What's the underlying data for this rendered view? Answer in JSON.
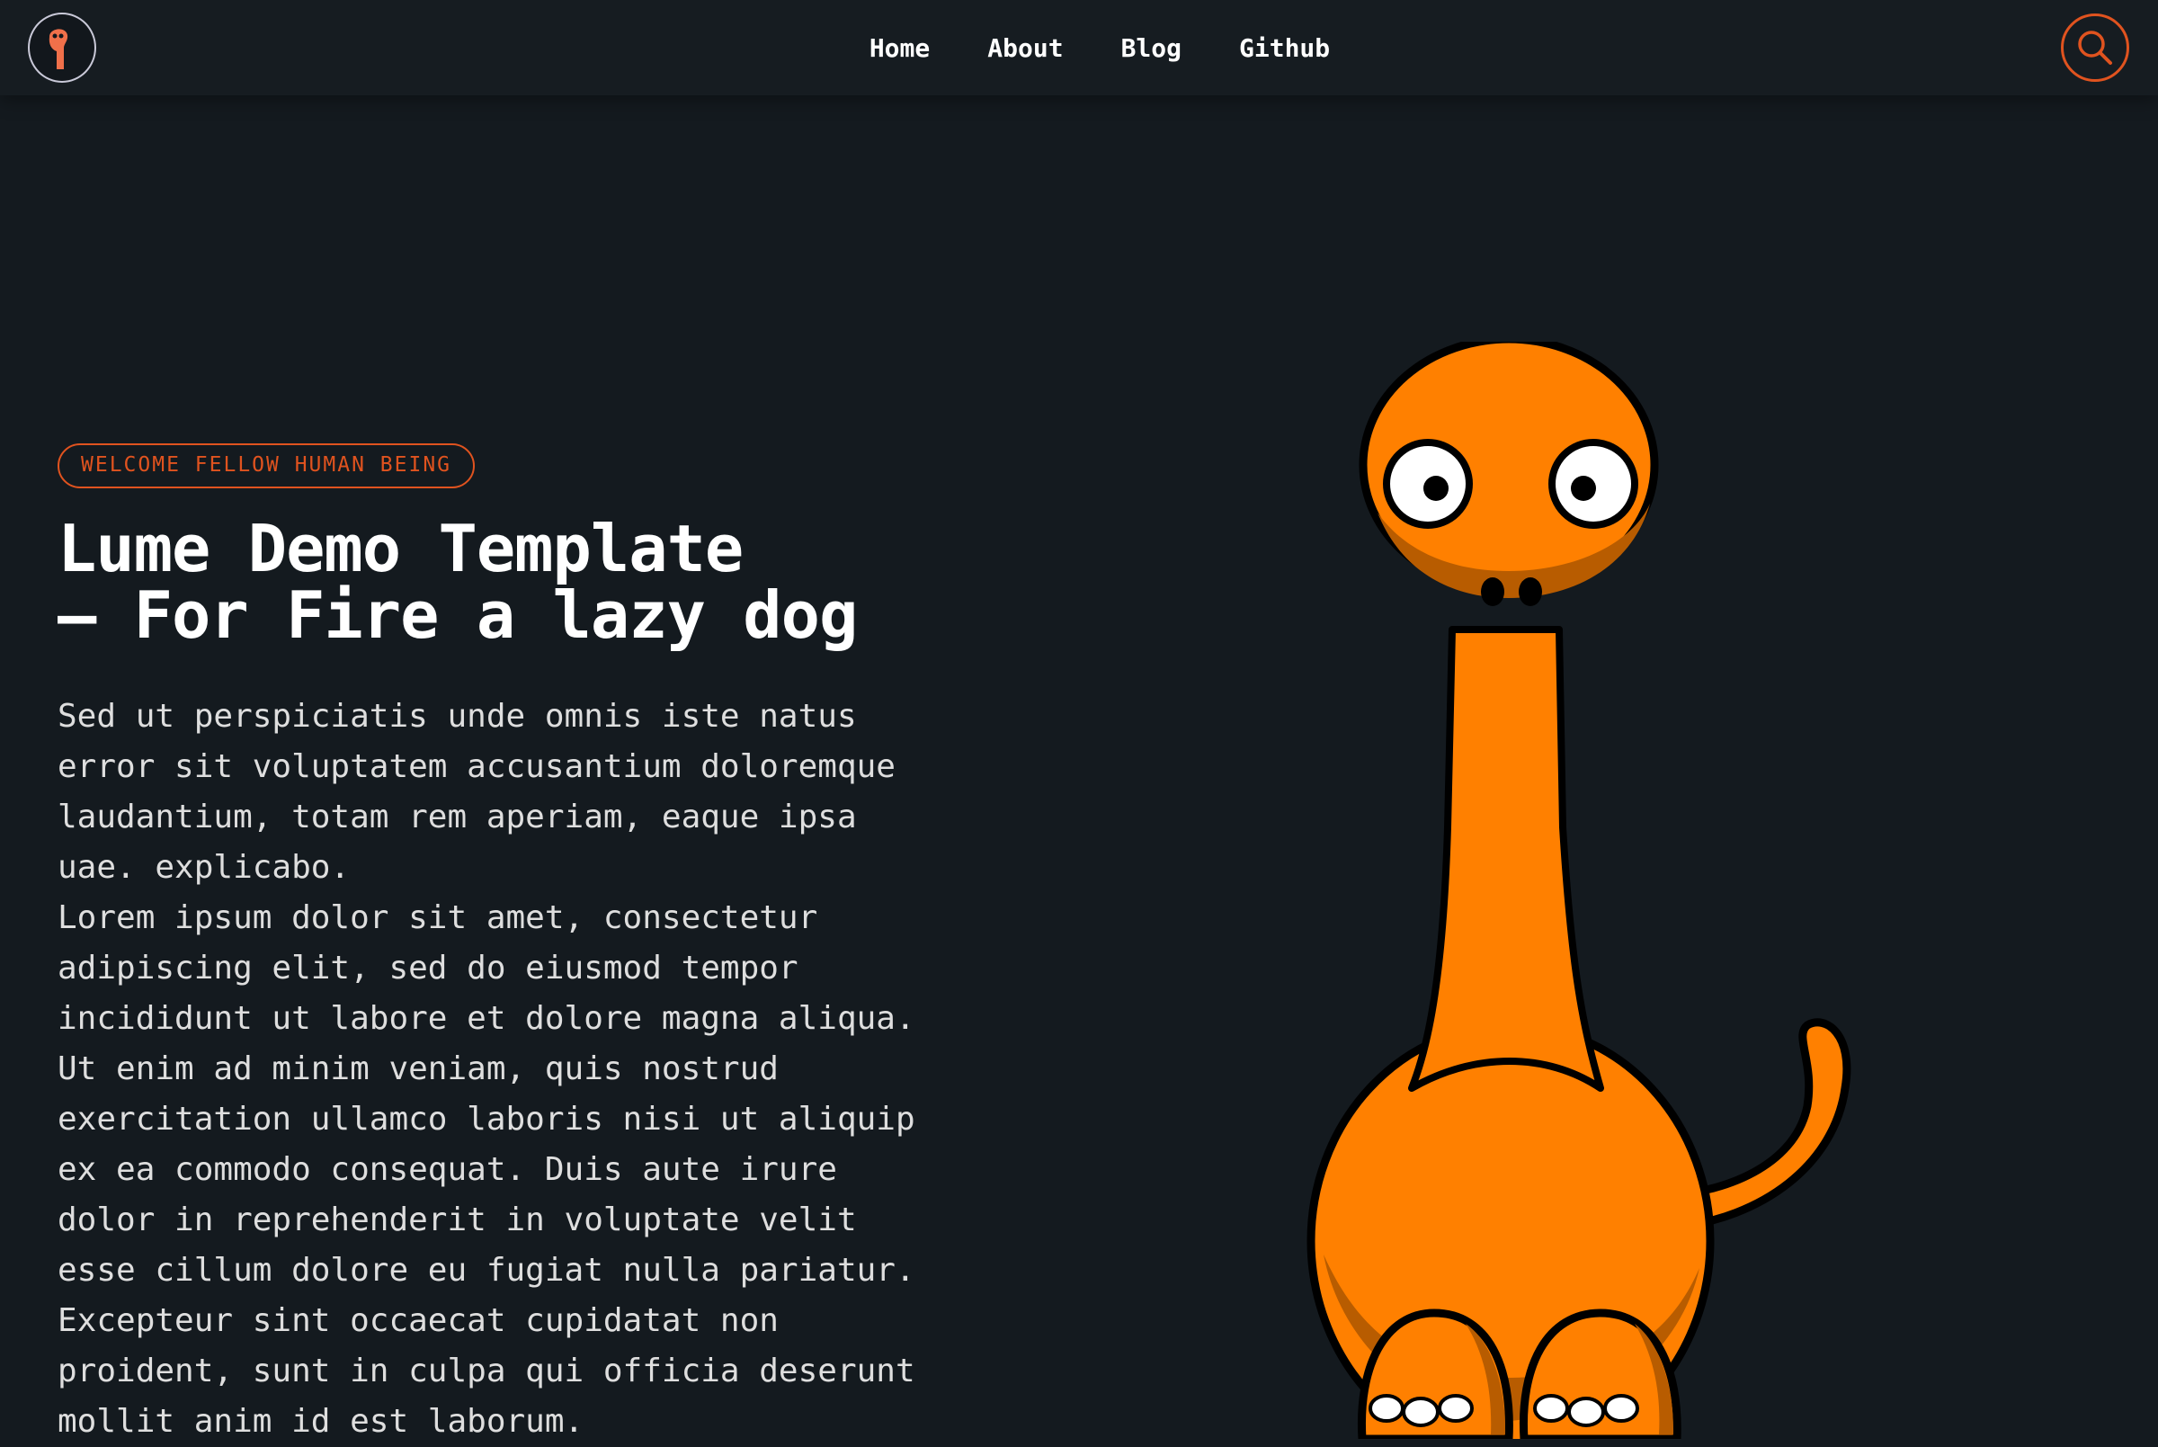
{
  "nav": {
    "links": [
      "Home",
      "About",
      "Blog",
      "Github"
    ]
  },
  "hero": {
    "badge": "WELCOME FELLOW HUMAN BEING",
    "title_line1": "Lume Demo Template",
    "title_line2": "– For Fire a lazy dog",
    "paragraph1": "Sed ut perspiciatis unde omnis iste natus error sit voluptatem accusantium doloremque laudantium, totam rem aperiam, eaque ipsa uae. explicabo.",
    "paragraph2": "Lorem ipsum dolor sit amet, consectetur adipiscing elit, sed do eiusmod tempor incididunt ut labore et dolore magna aliqua. Ut enim ad minim veniam, quis nostrud exercitation ullamco laboris nisi ut aliquip ex ea commodo consequat. Duis aute irure dolor in reprehenderit in voluptate velit esse cillum dolore eu fugiat nulla pariatur. Excepteur sint occaecat cupidatat non proident, sunt in culpa qui officia deserunt mollit anim id est laborum."
  },
  "icons": {
    "logo": "dino-logo-icon",
    "search": "search-icon",
    "illustration": "dinosaur-illustration"
  },
  "colors": {
    "background": "#141a1f",
    "accent": "#e0531f",
    "dino_orange": "#ff8000"
  }
}
